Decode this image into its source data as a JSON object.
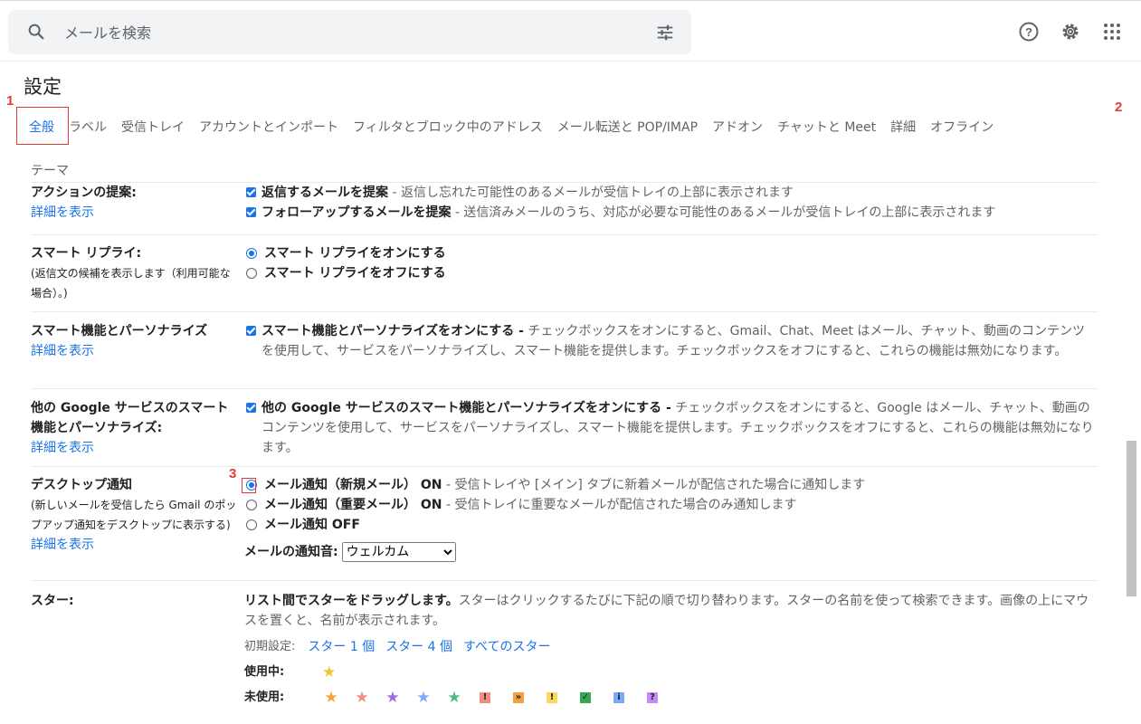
{
  "search": {
    "placeholder": "メールを検索"
  },
  "page_title": "設定",
  "tabs_row1": [
    "全般",
    "ラベル",
    "受信トレイ",
    "アカウントとインポート",
    "フィルタとブロック中のアドレス",
    "メール転送と POP/IMAP",
    "アドオン",
    "チャットと Meet",
    "詳細",
    "オフライン"
  ],
  "tabs_row2": [
    "テーマ"
  ],
  "annotations": {
    "a1": "1",
    "a2": "2",
    "a3": "3"
  },
  "details_link": "詳細を表示",
  "action_suggest": {
    "label": "アクションの提案:",
    "opt1_bold": "返信するメールを提案",
    "opt1_desc": " - 返信し忘れた可能性のあるメールが受信トレイの上部に表示されます",
    "opt2_bold": "フォローアップするメールを提案",
    "opt2_desc": " - 送信済みメールのうち、対応が必要な可能性のあるメールが受信トレイの上部に表示されます"
  },
  "smart_reply": {
    "label": "スマート リプライ:",
    "sub": "(返信文の候補を表示します（利用可能な場合）。)",
    "on": "スマート リプライをオンにする",
    "off": "スマート リプライをオフにする"
  },
  "smart_features": {
    "label": "スマート機能とパーソナライズ",
    "bold": "スマート機能とパーソナライズをオンにする -",
    "desc": " チェックボックスをオンにすると、Gmail、Chat、Meet はメール、チャット、動画のコンテンツを使用して、サービスをパーソナライズし、スマート機能を提供します。チェックボックスをオフにすると、これらの機能は無効になります。"
  },
  "google_smart": {
    "label": "他の Google サービスのスマート機能とパーソナライズ:",
    "bold": "他の Google サービスのスマート機能とパーソナライズをオンにする -",
    "desc": " チェックボックスをオンにすると、Google はメール、チャット、動画のコンテンツを使用して、サービスをパーソナライズし、スマート機能を提供します。チェックボックスをオフにすると、これらの機能は無効になります。"
  },
  "desktop": {
    "label": "デスクトップ通知",
    "sub": "(新しいメールを受信したら Gmail のポップアップ通知をデスクトップに表示する)",
    "opt1_bold": "メール通知（新規メール） ON",
    "opt1_desc": " - 受信トレイや [メイン] タブに新着メールが配信された場合に通知します",
    "opt2_bold": "メール通知（重要メール） ON",
    "opt2_desc": " - 受信トレイに重要なメールが配信された場合のみ通知します",
    "opt3_bold": "メール通知 OFF",
    "sound_label": "メールの通知音:",
    "sound_value": "ウェルカム"
  },
  "stars": {
    "label": "スター:",
    "intro_bold": "リスト間でスターをドラッグします。",
    "intro_desc": "スターはクリックするたびに下記の順で切り替わります。スターの名前を使って検索できます。画像の上にマウスを置くと、名前が表示されます。",
    "preset_label": "初期設定:",
    "preset1": "スター 1 個",
    "preset4": "スター 4 個",
    "preset_all": "すべてのスター",
    "in_use_label": "使用中:",
    "unused_label": "未使用:",
    "in_use": [
      {
        "icon": "yellow-star",
        "glyph": "★",
        "color": "#f4c430"
      }
    ],
    "unused": [
      {
        "icon": "orange-star",
        "glyph": "★",
        "color": "#f6a23c"
      },
      {
        "icon": "red-star",
        "glyph": "★",
        "color": "#f28b82"
      },
      {
        "icon": "purple-star",
        "glyph": "★",
        "color": "#a766d9"
      },
      {
        "icon": "blue-star",
        "glyph": "★",
        "color": "#7baaf7"
      },
      {
        "icon": "green-star",
        "glyph": "★",
        "color": "#4eb887"
      },
      {
        "icon": "red-bang",
        "glyph": "!",
        "color": "#f28b82"
      },
      {
        "icon": "orange-guillemet",
        "glyph": "»",
        "color": "#f6a23c"
      },
      {
        "icon": "yellow-bang",
        "glyph": "!",
        "color": "#fbd75b"
      },
      {
        "icon": "green-check",
        "glyph": "✓",
        "color": "#34a853"
      },
      {
        "icon": "blue-info",
        "glyph": "i",
        "color": "#7baaf7"
      },
      {
        "icon": "purple-question",
        "glyph": "?",
        "color": "#c58af9"
      }
    ]
  }
}
